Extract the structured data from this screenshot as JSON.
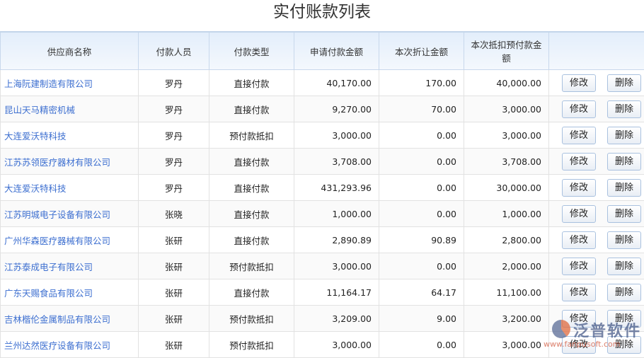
{
  "title": "实付账款列表",
  "headers": [
    "供应商名称",
    "付款人员",
    "付款类型",
    "申请付款金额",
    "本次折让金额",
    "本次抵扣预付款金额",
    ""
  ],
  "rows": [
    [
      "上海阮建制造有限公司",
      "罗丹",
      "直接付款",
      "40,170.00",
      "170.00",
      "40,000.00"
    ],
    [
      "昆山天马精密机械",
      "罗丹",
      "直接付款",
      "9,270.00",
      "70.00",
      "3,000.00"
    ],
    [
      "大连爱沃特科技",
      "罗丹",
      "预付款抵扣",
      "3,000.00",
      "0.00",
      "3,000.00"
    ],
    [
      "江苏苏领医疗器材有限公司",
      "罗丹",
      "直接付款",
      "3,708.00",
      "0.00",
      "3,708.00"
    ],
    [
      "大连爱沃特科技",
      "罗丹",
      "直接付款",
      "431,293.96",
      "0.00",
      "30,000.00"
    ],
    [
      "江苏明城电子设备有限公司",
      "张晓",
      "直接付款",
      "1,000.00",
      "0.00",
      "1,000.00"
    ],
    [
      "广州华森医疗器械有限公司",
      "张研",
      "直接付款",
      "2,890.89",
      "90.89",
      "2,800.00"
    ],
    [
      "江苏泰成电子有限公司",
      "张研",
      "预付款抵扣",
      "3,000.00",
      "0.00",
      "2,000.00"
    ],
    [
      "广东天赐食品有限公司",
      "张研",
      "直接付款",
      "11,164.17",
      "64.17",
      "11,100.00"
    ],
    [
      "吉林楷伦金属制品有限公司",
      "张研",
      "预付款抵扣",
      "3,209.00",
      "9.00",
      "3,200.00"
    ],
    [
      "兰州达然医疗设备有限公司",
      "张研",
      "预付款抵扣",
      "3,000.00",
      "0.00",
      "3,000.00"
    ]
  ],
  "actions": {
    "edit": "修改",
    "delete": "删除"
  },
  "watermark": {
    "brand": "泛普软件",
    "url": "www.fanpusoft.com"
  }
}
